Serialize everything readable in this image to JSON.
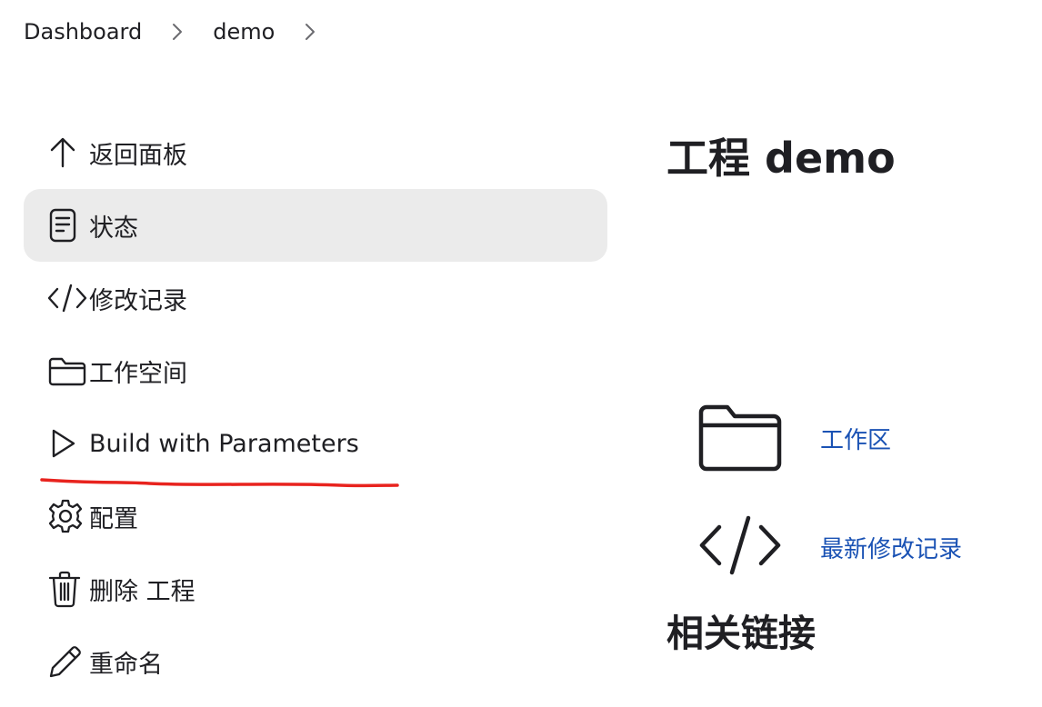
{
  "breadcrumb": {
    "items": [
      {
        "label": "Dashboard"
      },
      {
        "label": "demo"
      }
    ]
  },
  "sidebar": {
    "items": [
      {
        "label": "返回面板",
        "icon": "arrow-up-icon"
      },
      {
        "label": "状态",
        "icon": "document-icon",
        "active": true
      },
      {
        "label": "修改记录",
        "icon": "code-icon"
      },
      {
        "label": "工作空间",
        "icon": "folder-icon"
      },
      {
        "label": "Build with Parameters",
        "icon": "play-icon"
      },
      {
        "label": "配置",
        "icon": "gear-icon"
      },
      {
        "label": "删除 工程",
        "icon": "trash-icon"
      },
      {
        "label": "重命名",
        "icon": "pencil-icon"
      }
    ]
  },
  "main": {
    "title": "工程 demo",
    "links": [
      {
        "label": "工作区",
        "icon": "folder-icon"
      },
      {
        "label": "最新修改记录",
        "icon": "code-icon"
      }
    ],
    "related_title": "相关链接"
  },
  "colors": {
    "text": "#1f1f23",
    "active_bg": "#ebebeb",
    "link": "#1a52b4",
    "annotation": "#e8231e"
  }
}
